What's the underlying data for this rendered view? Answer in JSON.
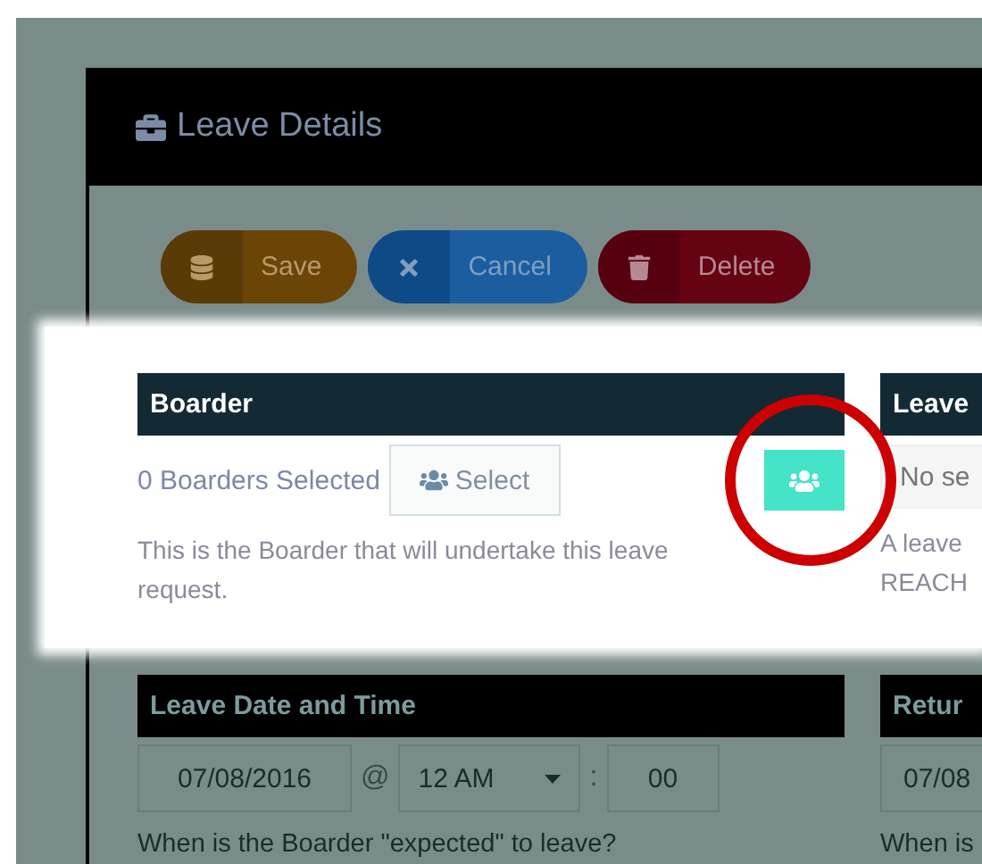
{
  "modal": {
    "title": "Leave Details"
  },
  "toolbar": [
    {
      "kind": "save",
      "label": "Save"
    },
    {
      "kind": "cancel",
      "label": "Cancel"
    },
    {
      "kind": "delete",
      "label": "Delete"
    }
  ],
  "boarder": {
    "heading": "Boarder",
    "count": "0 Boarders Selected",
    "select_label": "Select",
    "help": "This is the Boarder that will undertake this leave request.",
    "highlighted": true
  },
  "leave_column": {
    "heading": "Leave",
    "placeholder": "No se",
    "help_lines": [
      "A leave",
      "REACH"
    ]
  },
  "leave_date": {
    "heading": "Leave Date and Time",
    "date": "07/08/2016",
    "at": "@",
    "hour": "12 AM",
    "separator": ":",
    "minute": "00",
    "help": "When is the Boarder \"expected\" to leave?"
  },
  "return_date": {
    "heading": "Retur",
    "date": "07/08",
    "help": "When is"
  }
}
